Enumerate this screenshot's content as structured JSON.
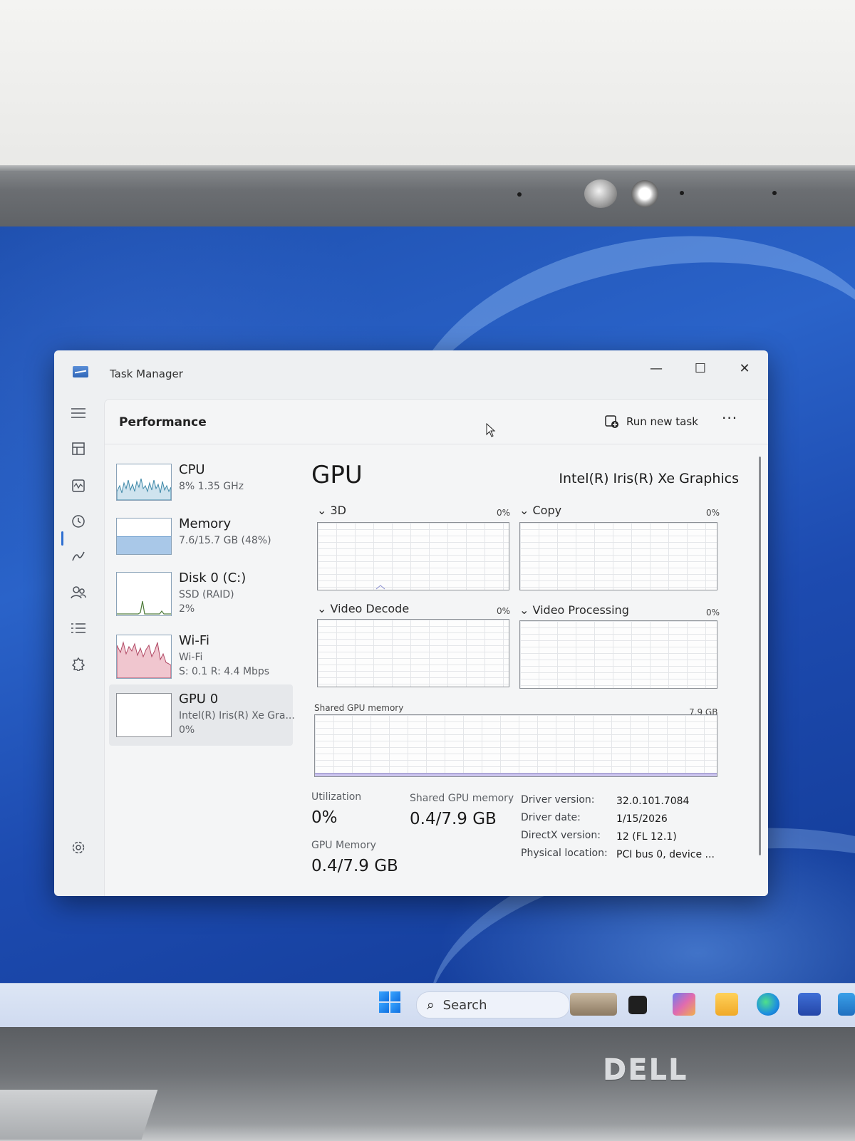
{
  "window": {
    "title": "Task Manager",
    "minimize": "—",
    "maximize": "☐",
    "close": "✕"
  },
  "header": {
    "title": "Performance",
    "run_task": "Run new task",
    "more": "···"
  },
  "devices": [
    {
      "name": "CPU",
      "line1": "8%  1.35 GHz",
      "line2": ""
    },
    {
      "name": "Memory",
      "line1": "7.6/15.7 GB (48%)",
      "line2": ""
    },
    {
      "name": "Disk 0 (C:)",
      "line1": "SSD (RAID)",
      "line2": "2%"
    },
    {
      "name": "Wi-Fi",
      "line1": "Wi-Fi",
      "line2": "S: 0.1  R: 4.4 Mbps"
    },
    {
      "name": "GPU 0",
      "line1": "Intel(R) Iris(R) Xe Gra...",
      "line2": "0%"
    }
  ],
  "gpu": {
    "heading": "GPU",
    "model": "Intel(R) Iris(R) Xe Graphics",
    "engines": [
      {
        "label": "3D",
        "percent": "0%"
      },
      {
        "label": "Copy",
        "percent": "0%"
      },
      {
        "label": "Video Decode",
        "percent": "0%"
      },
      {
        "label": "Video Processing",
        "percent": "0%"
      }
    ],
    "shared_label": "Shared GPU memory",
    "shared_max": "7.9 GB",
    "stats": {
      "utilization_label": "Utilization",
      "utilization_value": "0%",
      "shared_label": "Shared GPU memory",
      "shared_value": "0.4/7.9 GB",
      "gpu_memory_label": "GPU Memory",
      "gpu_memory_value": "0.4/7.9 GB"
    },
    "details": [
      {
        "key": "Driver version:",
        "value": "32.0.101.7084"
      },
      {
        "key": "Driver date:",
        "value": "1/15/2026"
      },
      {
        "key": "DirectX version:",
        "value": "12 (FL 12.1)"
      },
      {
        "key": "Physical location:",
        "value": "PCI bus 0, device ..."
      }
    ]
  },
  "taskbar": {
    "search_placeholder": "Search"
  },
  "brand": "DELL",
  "colors": {
    "accent": "#2f6fd1",
    "memory_fill": "#a9c8e8",
    "wifi_fill": "#e4a3b3"
  }
}
